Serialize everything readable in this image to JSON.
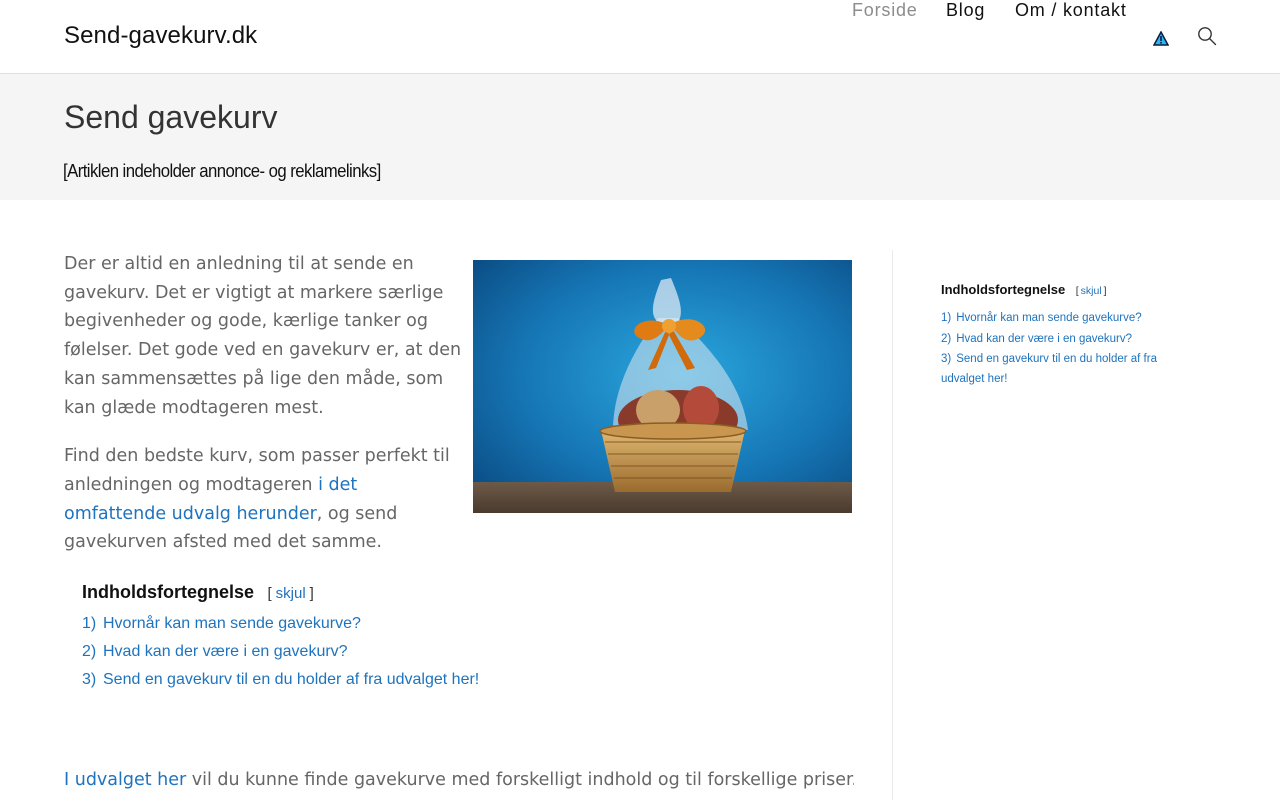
{
  "header": {
    "logo": "Send-gavekurv.dk",
    "nav": [
      {
        "label": "Forside",
        "active": true
      },
      {
        "label": "Blog",
        "active": false
      },
      {
        "label": "Om / kontakt",
        "active": false
      }
    ],
    "icons": [
      "warning-flag-icon",
      "search-icon"
    ]
  },
  "title_band": {
    "title": "Send gavekurv",
    "disclaimer": "[Artiklen indeholder annonce- og reklamelinks]"
  },
  "intro": {
    "p1": "Der er altid en anledning til at sende en gavekurv. Det er vigtigt at markere særlige begivenheder og gode, kærlige tanker og følelser. Det gode ved en gavekurv er, at den kan sammensættes på lige den måde, som kan glæde modtageren mest.",
    "p2_before": "Find den bedste kurv, som passer perfekt til anledningen og modtageren ",
    "p2_link": "i det omfattende udvalg herunder",
    "p2_after": ", og send gavekurven afsted med det samme."
  },
  "toc": {
    "heading": "Indholdsfortegnelse",
    "open_bracket": "[",
    "toggle_label": "skjul",
    "close_bracket": "]",
    "items": [
      {
        "num": "1)",
        "label": "Hvornår kan man sende gavekurve?"
      },
      {
        "num": "2)",
        "label": "Hvad kan der være i en gavekurv?"
      },
      {
        "num": "3)",
        "label": "Send en gavekurv til en du holder af fra udvalget her!"
      }
    ]
  },
  "bottom": {
    "link": "I udvalget her",
    "text": " vil du kunne finde gavekurve med forskelligt indhold og til forskellige priser. Der skal"
  },
  "colors": {
    "link": "#1e73be",
    "nav_active": "#8c8c8c",
    "band_bg": "#f5f5f5",
    "body_text": "#666666"
  }
}
